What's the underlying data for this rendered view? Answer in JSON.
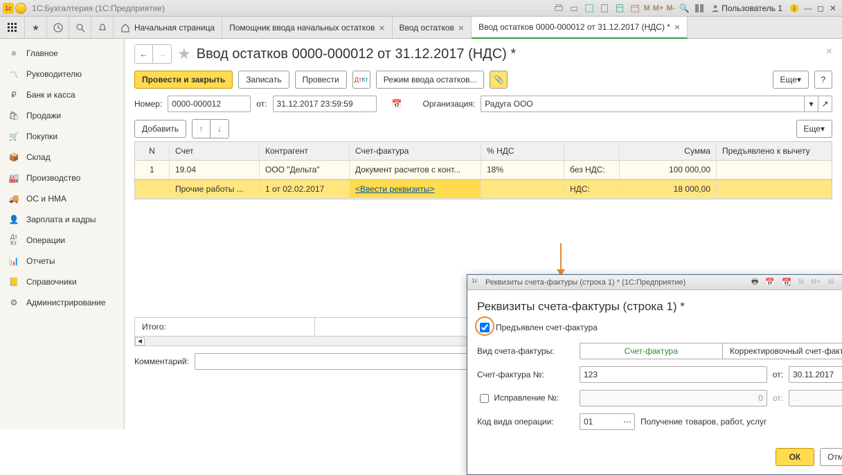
{
  "window": {
    "app_title": "1С:Бухгалтерия  (1С:Предприятие)",
    "user": "Пользователь 1"
  },
  "tabs": {
    "home": "Начальная страница",
    "t1": "Помощник ввода начальных остатков",
    "t2": "Ввод остатков",
    "t3": "Ввод остатков 0000-000012 от 31.12.2017 (НДС) *"
  },
  "page": {
    "title": "Ввод остатков 0000-000012 от 31.12.2017 (НДС) *",
    "btn_post_close": "Провести и закрыть",
    "btn_save": "Записать",
    "btn_post": "Провести",
    "btn_mode": "Режим ввода остатков...",
    "btn_more": "Еще",
    "label_number": "Номер:",
    "value_number": "0000-000012",
    "label_date": "от:",
    "value_date": "31.12.2017 23:59:59",
    "label_org": "Организация:",
    "value_org": "Радуга ООО",
    "btn_add": "Добавить",
    "btn_more2": "Еще",
    "comment_label": "Комментарий:",
    "total_label": "Итого:"
  },
  "table": {
    "col_n": "N",
    "col_account": "Счет",
    "col_counterparty": "Контрагент",
    "col_invoice": "Счет-фактура",
    "col_vat": "% НДС",
    "col_sum": "Сумма",
    "col_deduct": "Предъявлено к вычету",
    "rows": [
      {
        "n": "1",
        "account": "19.04",
        "ctr": "ООО \"Дельта\"",
        "sf": "Документ расчетов с конт...",
        "vat": "18%",
        "type": "без НДС:",
        "sum": "100 000,00"
      },
      {
        "n": "",
        "account": "Прочие работы ...",
        "ctr": "1 от 02.02.2017",
        "sf": "<Ввести реквизиты>",
        "vat": "",
        "type": "НДС:",
        "sum": "18 000,00"
      }
    ]
  },
  "sidebar": {
    "items": [
      "Главное",
      "Руководителю",
      "Банк и касса",
      "Продажи",
      "Покупки",
      "Склад",
      "Производство",
      "ОС и НМА",
      "Зарплата и кадры",
      "Операции",
      "Отчеты",
      "Справочники",
      "Администрирование"
    ]
  },
  "dialog": {
    "title": "Реквизиты счета-фактуры (строка 1) *  (1С:Предприятие)",
    "heading": "Реквизиты счета-фактуры (строка 1) *",
    "chk_presented": "Предъявлен счет-фактура",
    "label_type": "Вид счета-фактуры:",
    "seg_invoice": "Счет-фактура",
    "seg_corr": "Корректировочный счет-фактура",
    "label_sf_no": "Счет-фактура №:",
    "value_sf_no": "123",
    "label_from": "от:",
    "value_sf_date": "30.11.2017",
    "label_corr_no": "Исправление №:",
    "value_corr_no": "0",
    "value_corr_date": "  .  .    ",
    "label_op": "Код вида операции:",
    "value_op": "01",
    "op_desc": "Получение товаров, работ, услуг",
    "btn_ok": "ОК",
    "btn_cancel": "Отмена"
  },
  "titlebar_markers": {
    "m": "M",
    "mp": "M+",
    "mm": "M-"
  }
}
